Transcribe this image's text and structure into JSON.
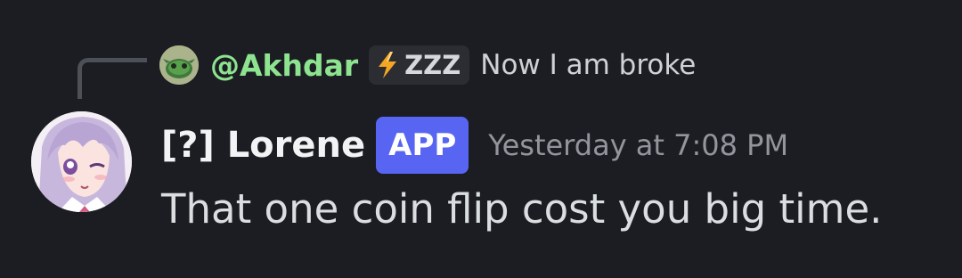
{
  "reply": {
    "author": "@Akhdar",
    "tag_text": "ZZZ",
    "tag_icon": "lightning-bolt-icon",
    "text": "Now I am broke",
    "name_color": "#8de38f"
  },
  "message": {
    "author": "[?] Lorene",
    "badge": "APP",
    "timestamp": "Yesterday at 7:08 PM",
    "content": "That one coin flip cost you big time."
  },
  "colors": {
    "background": "#1c1d22",
    "badge": "#5865f2",
    "tag_bolt": "#f5a623"
  }
}
